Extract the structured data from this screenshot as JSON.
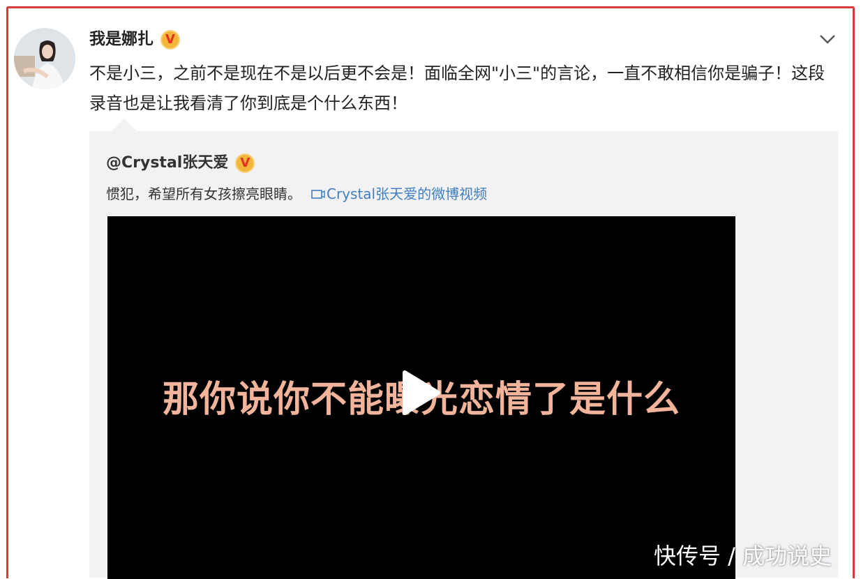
{
  "post": {
    "username": "我是娜扎",
    "verified_badge": "V",
    "text": "不是小三，之前不是现在不是以后更不会是！面临全网\"小三\"的言论，一直不敢相信你是骗子！这段录音也是让我看清了你到底是个什么东西！",
    "menu_icon": "chevron-down-icon"
  },
  "quoted": {
    "username": "@Crystal张天爱",
    "verified_badge": "V",
    "text": "惯犯，希望所有女孩擦亮眼睛。",
    "video_link": "Crystal张天爱的微博视频",
    "video_link_icon": "video-icon"
  },
  "video": {
    "subtitle": "那你说你不能曝光恋情了是什么",
    "play_icon": "play-icon"
  },
  "watermark": "快传号 / 成功说史",
  "colors": {
    "frame": "#d93a3a",
    "link": "#3f7fc1",
    "badge": "#f4b63a",
    "subtitle": "#f2b49a"
  }
}
